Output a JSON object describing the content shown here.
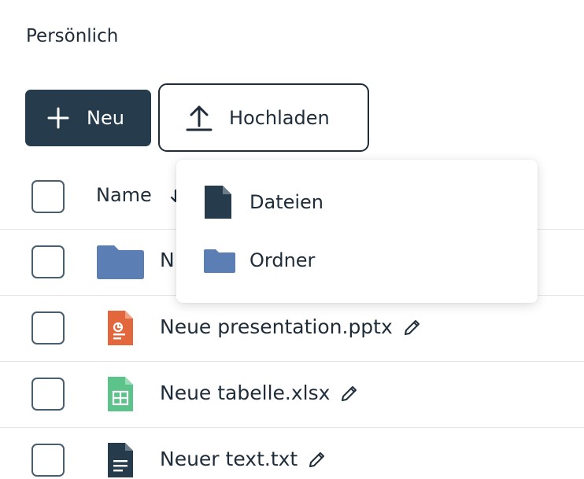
{
  "breadcrumb": "Persönlich",
  "toolbar": {
    "new_label": "Neu",
    "upload_label": "Hochladen"
  },
  "table": {
    "name_header": "Name"
  },
  "files": [
    {
      "name": "N",
      "type": "folder",
      "icon": "folder-icon"
    },
    {
      "name": "Neue presentation.pptx",
      "type": "pptx",
      "icon": "presentation-file-icon"
    },
    {
      "name": "Neue tabelle.xlsx",
      "type": "xlsx",
      "icon": "spreadsheet-file-icon"
    },
    {
      "name": "Neuer text.txt",
      "type": "txt",
      "icon": "text-file-icon"
    }
  ],
  "upload_menu": {
    "items": [
      {
        "label": "Dateien",
        "icon": "file-icon"
      },
      {
        "label": "Ordner",
        "icon": "folder-icon"
      }
    ]
  },
  "colors": {
    "primary_dark": "#263b4b",
    "folder_blue": "#5b7fb5",
    "pptx_orange": "#e2673c",
    "xlsx_green": "#5cc38a",
    "text_dark": "#1f2d3a"
  }
}
